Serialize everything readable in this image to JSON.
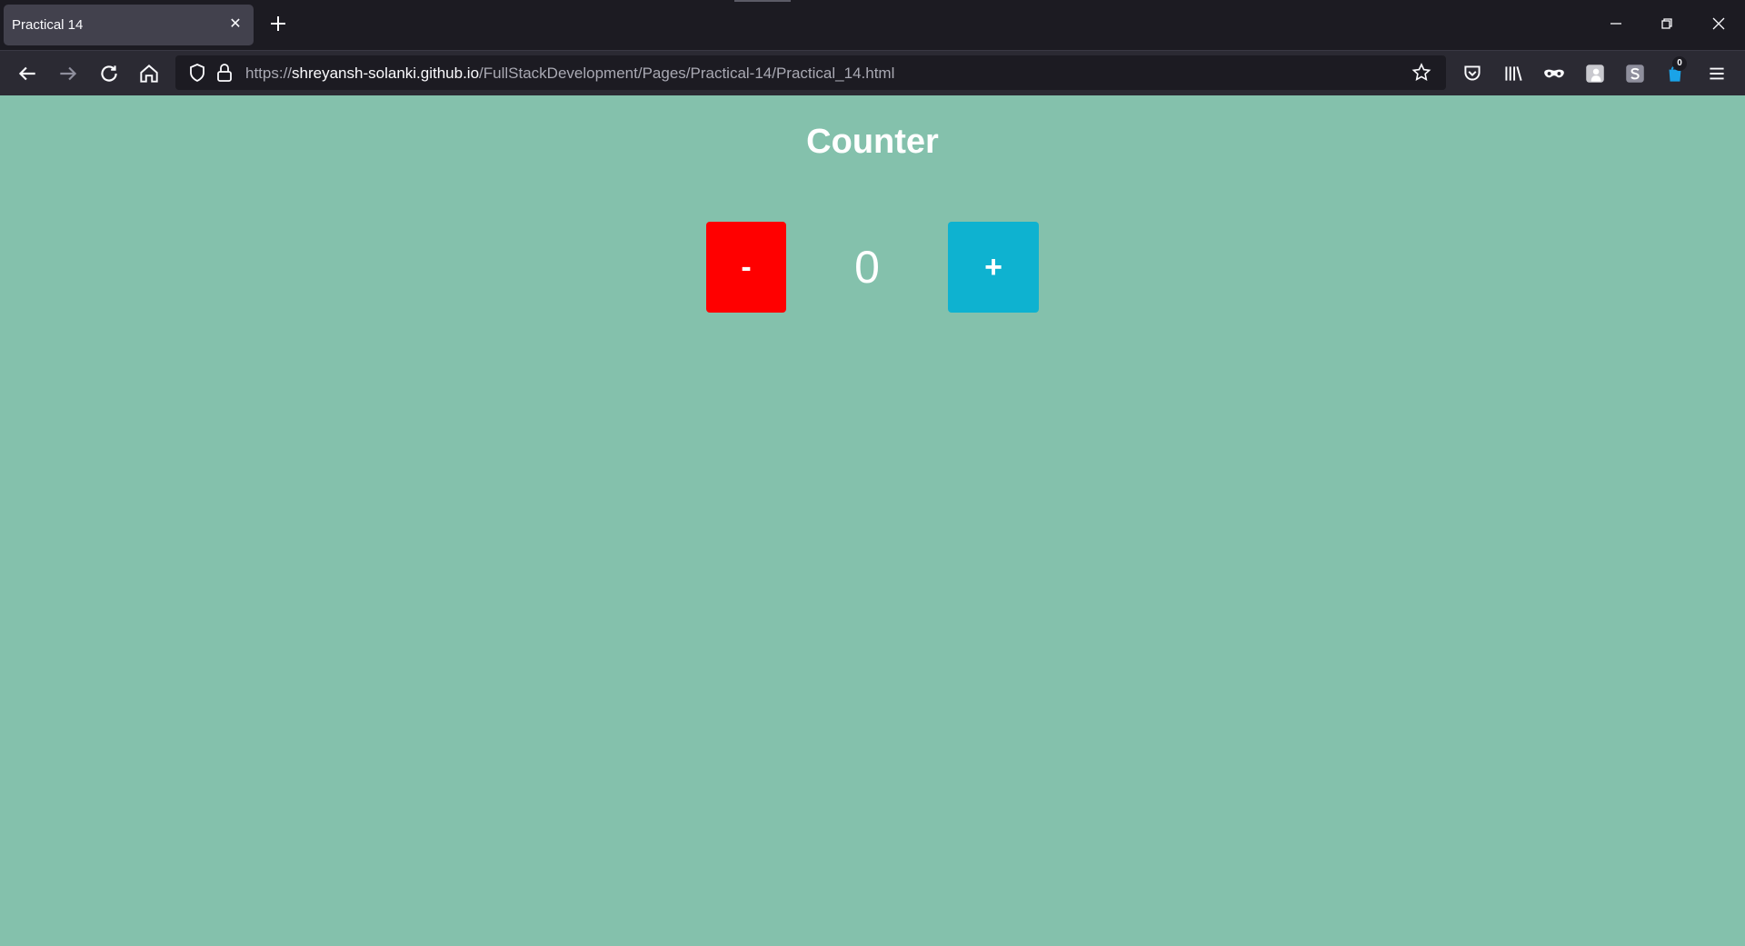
{
  "browser": {
    "tab": {
      "title": "Practical 14",
      "close_glyph": "✕"
    },
    "url": {
      "scheme": "https://",
      "host": "shreyansh-solanki.github.io",
      "path": "/FullStackDevelopment/Pages/Practical-14/Practical_14.html"
    },
    "extension_badge": "0",
    "icons": [
      "new-tab-icon",
      "minimize-icon",
      "restore-icon",
      "close-window-icon",
      "back-arrow-icon",
      "forward-arrow-icon",
      "reload-icon",
      "home-icon",
      "shield-icon",
      "lock-icon",
      "bookmark-star-icon",
      "pocket-icon",
      "library-icon",
      "incognito-mask-icon",
      "extension-icon",
      "s-extension-icon",
      "notification-extension-icon",
      "menu-hamburger-icon"
    ]
  },
  "page": {
    "title": "Counter",
    "decrement_label": "-",
    "counter_value": "0",
    "increment_label": "+",
    "colors": {
      "background": "#84c1ac",
      "decrement": "#ff0000",
      "increment": "#0eb2d0"
    }
  }
}
